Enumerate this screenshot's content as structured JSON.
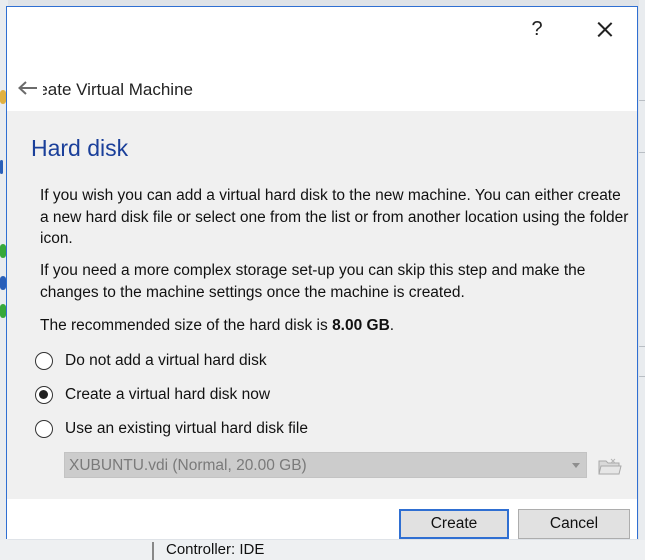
{
  "dialog": {
    "help_label": "?",
    "wizard_title": "Create Virtual Machine"
  },
  "page": {
    "title": "Hard disk",
    "para1": "If you wish you can add a virtual hard disk to the new machine. You can either create a new hard disk file or select one from the list or from another location using the folder icon.",
    "para2": "If you need a more complex storage set-up you can skip this step and make the changes to the machine settings once the machine is created.",
    "recommended_prefix": "The recommended size of the hard disk is ",
    "recommended_size": "8.00 GB",
    "recommended_suffix": "."
  },
  "options": [
    {
      "label": "Do not add a virtual hard disk",
      "selected": false
    },
    {
      "label": "Create a virtual hard disk now",
      "selected": true
    },
    {
      "label": "Use an existing virtual hard disk file",
      "selected": false
    }
  ],
  "disk_select": {
    "value": "XUBUNTU.vdi (Normal, 20.00 GB)",
    "enabled": false
  },
  "buttons": {
    "create": "Create",
    "cancel": "Cancel"
  },
  "background": {
    "bottom_text": "Controller: IDE"
  },
  "colors": {
    "accent": "#2f6fd2",
    "title": "#1a3f9a"
  }
}
